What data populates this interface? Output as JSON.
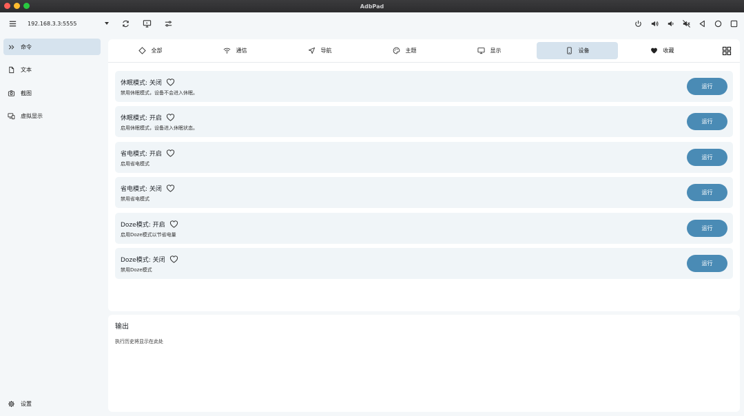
{
  "window": {
    "title": "AdbPad"
  },
  "toolbar": {
    "device": "192.168.3.3:5555"
  },
  "sidebar": {
    "items": [
      {
        "label": "命令",
        "icon": "chevrons-right-icon",
        "active": true
      },
      {
        "label": "文本",
        "icon": "document-icon",
        "active": false
      },
      {
        "label": "截图",
        "icon": "camera-icon",
        "active": false
      },
      {
        "label": "虚拟显示",
        "icon": "devices-icon",
        "active": false
      }
    ],
    "settings_label": "设置"
  },
  "tabs": [
    {
      "label": "全部",
      "icon": "diamond-icon",
      "active": false
    },
    {
      "label": "通信",
      "icon": "wifi-icon",
      "active": false
    },
    {
      "label": "导航",
      "icon": "navigation-icon",
      "active": false
    },
    {
      "label": "主题",
      "icon": "palette-icon",
      "active": false
    },
    {
      "label": "显示",
      "icon": "monitor-icon",
      "active": false
    },
    {
      "label": "设备",
      "icon": "phone-icon",
      "active": true
    },
    {
      "label": "收藏",
      "icon": "heart-filled-icon",
      "active": false
    }
  ],
  "commands": [
    {
      "title": "休眠模式: 关闭",
      "desc": "禁用休眠模式，设备不会进入休眠。",
      "run_label": "运行"
    },
    {
      "title": "休眠模式: 开启",
      "desc": "启用休眠模式，设备进入休眠状态。",
      "run_label": "运行"
    },
    {
      "title": "省电模式: 开启",
      "desc": "启用省电模式",
      "run_label": "运行"
    },
    {
      "title": "省电模式: 关闭",
      "desc": "禁用省电模式",
      "run_label": "运行"
    },
    {
      "title": "Doze模式: 开启",
      "desc": "启用Doze模式以节省电量",
      "run_label": "运行"
    },
    {
      "title": "Doze模式: 关闭",
      "desc": "禁用Doze模式",
      "run_label": "运行"
    }
  ],
  "output": {
    "title": "输出",
    "placeholder": "执行历史将显示在此处"
  },
  "colors": {
    "accent": "#4a8bb5",
    "active_bg": "#d6e3ee",
    "card_bg": "#f0f5f8"
  }
}
